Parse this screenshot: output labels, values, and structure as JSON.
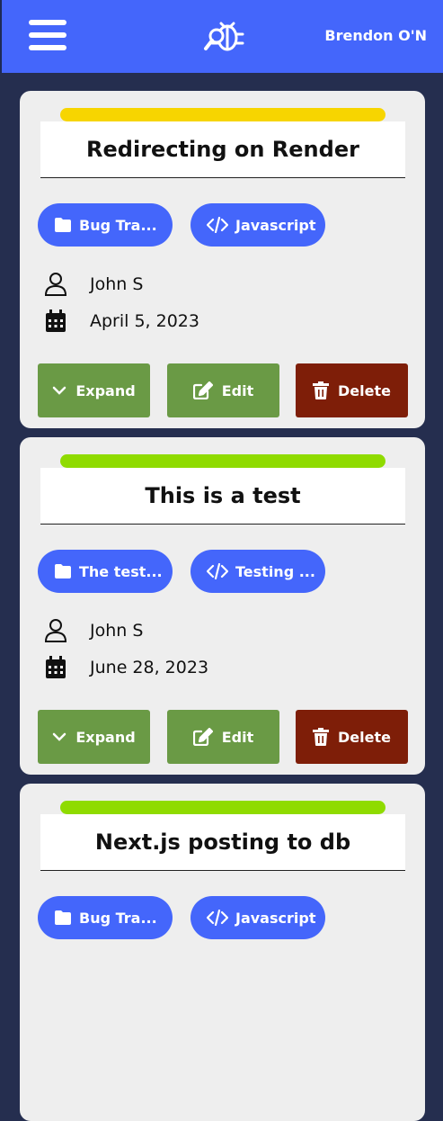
{
  "header": {
    "user_name": "Brendon O'N"
  },
  "tickets": [
    {
      "title": "Redirecting on Render",
      "status_color": "#f7d500",
      "project": "Bug Tra...",
      "language": "Javascript",
      "assignee": "John S",
      "date": "April 5, 2023"
    },
    {
      "title": "This is a test",
      "status_color": "#8fdb00",
      "project": "The test...",
      "language": "Testing ...",
      "assignee": "John S",
      "date": "June 28, 2023"
    },
    {
      "title": "Next.js posting to db",
      "status_color": "#8fdb00",
      "project": "Bug Tra...",
      "language": "Javascript",
      "assignee": "",
      "date": ""
    }
  ],
  "actions": {
    "expand_label": "Expand",
    "edit_label": "Edit",
    "delete_label": "Delete"
  },
  "colors": {
    "header": "#4466fb",
    "background": "#252e4f",
    "pill": "#4466fb",
    "expand": "#6a9a45",
    "edit": "#6a9a45",
    "delete": "#7e1e08"
  },
  "icons": [
    "menu-icon",
    "bug-search-logo",
    "folder-icon",
    "code-icon",
    "user-icon",
    "calendar-icon",
    "chevron-down-icon",
    "edit-icon",
    "trash-icon"
  ]
}
